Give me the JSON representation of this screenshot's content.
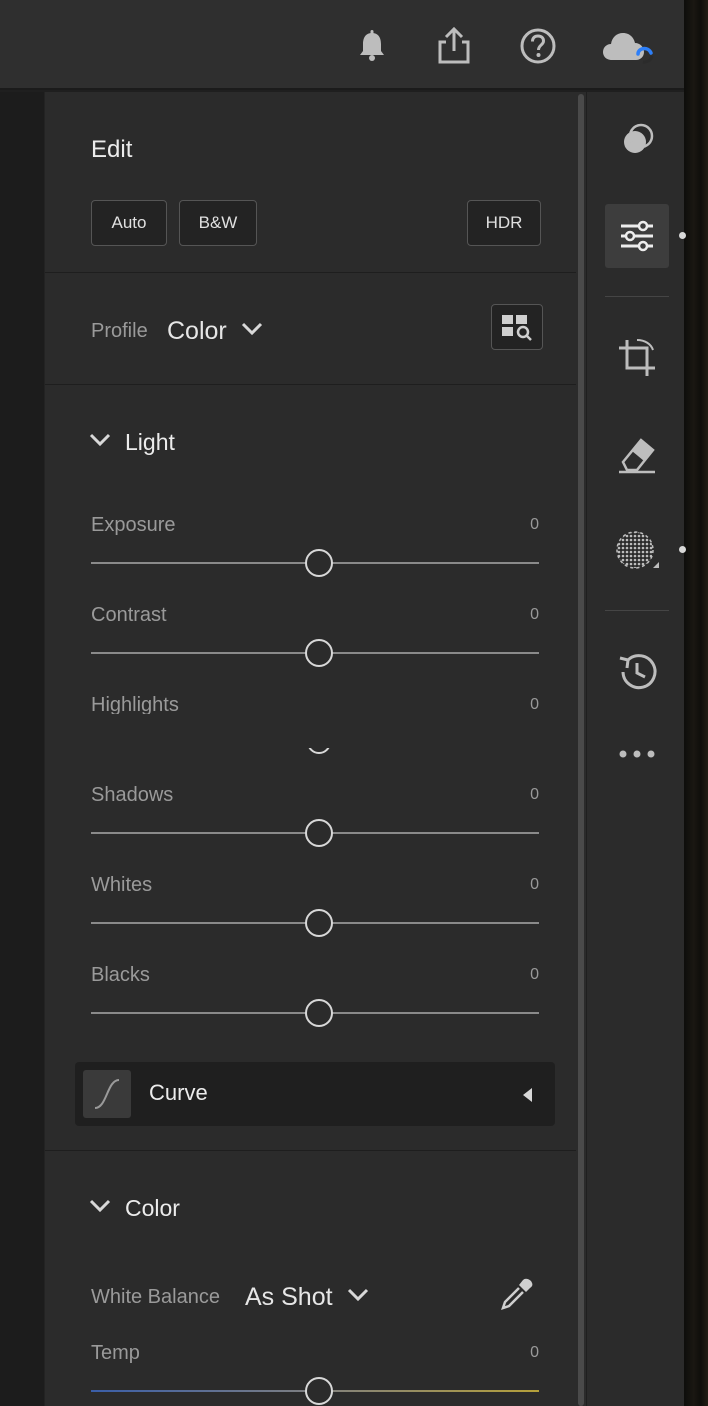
{
  "panel": {
    "title": "Edit",
    "buttons": {
      "auto": "Auto",
      "bw": "B&W",
      "hdr": "HDR"
    },
    "profile": {
      "label": "Profile",
      "value": "Color"
    },
    "light": {
      "title": "Light",
      "sliders": [
        {
          "label": "Exposure",
          "value": "0"
        },
        {
          "label": "Contrast",
          "value": "0"
        },
        {
          "label": "Highlights",
          "value": "0"
        },
        {
          "label": "Shadows",
          "value": "0"
        },
        {
          "label": "Whites",
          "value": "0"
        },
        {
          "label": "Blacks",
          "value": "0"
        }
      ],
      "curve_label": "Curve"
    },
    "color": {
      "title": "Color",
      "white_balance": {
        "label": "White Balance",
        "value": "As Shot"
      },
      "temp": {
        "label": "Temp",
        "value": "0"
      }
    }
  },
  "icons": {
    "topbar": [
      "bell-icon",
      "share-icon",
      "help-icon",
      "cloud-sync-icon"
    ],
    "rail": [
      "presets-icon",
      "edit-sliders-icon",
      "crop-icon",
      "healing-icon",
      "masking-icon",
      "history-icon",
      "more-icon"
    ]
  },
  "colors": {
    "panel_bg": "#2b2b2b",
    "accent_blue": "#2d7ff9"
  }
}
